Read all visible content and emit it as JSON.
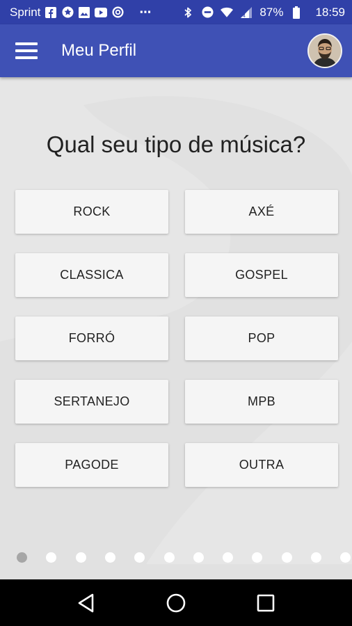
{
  "status_bar": {
    "carrier": "Sprint",
    "battery_percent": "87%",
    "time": "18:59",
    "more_indicator": "⋯",
    "icons": [
      "facebook-icon",
      "star-icon",
      "image-icon",
      "youtube-icon",
      "at-icon",
      "bluetooth-icon",
      "do-not-disturb-icon",
      "wifi-icon",
      "signal-icon",
      "battery-icon"
    ]
  },
  "app_bar": {
    "title": "Meu Perfil",
    "menu_icon": "hamburger-menu-icon",
    "avatar_icon": "profile-avatar"
  },
  "main": {
    "question": "Qual seu tipo de música?",
    "options": [
      "ROCK",
      "AXÉ",
      "CLASSICA",
      "GOSPEL",
      "FORRÓ",
      "POP",
      "SERTANEJO",
      "MPB",
      "PAGODE",
      "OUTRA"
    ],
    "pager": {
      "total_visible": 12,
      "active_index": 0
    }
  },
  "nav_bar": {
    "icons": [
      "back-icon",
      "home-icon",
      "recents-icon"
    ]
  },
  "colors": {
    "app_bar": "#3f51b5",
    "status_bar": "#3040a8",
    "background": "#e6e6e6",
    "button": "#f5f5f5"
  }
}
